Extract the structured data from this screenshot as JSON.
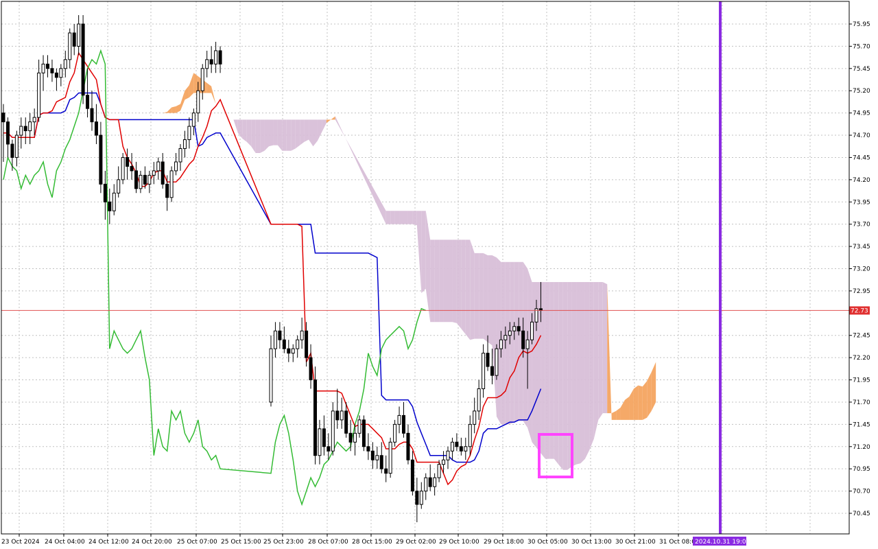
{
  "colors": {
    "background": "#ffffff",
    "grid": "#c0c0c0",
    "bull_candle": "#ffffff",
    "bear_candle": "#000000",
    "tenkan": "#e00000",
    "kijun": "#0000cc",
    "chikou": "#33bb33",
    "cloud_bull": "#f4a460",
    "cloud_bear": "#d8bfd8",
    "current_price_line": "#e05050",
    "vertical_marker": "#8a2be2",
    "highlight_box": "#ff44ff"
  },
  "chart_data": {
    "type": "candlestick",
    "indicator": "Ichimoku Kinko Hyo",
    "grid": true,
    "ylim": [
      70.25,
      76.1
    ],
    "y_ticks": [
      "75.95",
      "75.70",
      "75.45",
      "75.20",
      "74.95",
      "74.70",
      "74.45",
      "74.20",
      "73.95",
      "73.70",
      "73.45",
      "73.20",
      "72.95",
      "72.45",
      "72.20",
      "71.95",
      "71.70",
      "71.45",
      "71.20",
      "70.95",
      "70.70",
      "70.45"
    ],
    "x_ticks": [
      "23 Oct 2024",
      "24 Oct 04:00",
      "24 Oct 12:00",
      "24 Oct 20:00",
      "25 Oct 07:00",
      "25 Oct 15:00",
      "25 Oct 23:00",
      "28 Oct 07:00",
      "28 Oct 15:00",
      "29 Oct 02:00",
      "29 Oct 10:00",
      "29 Oct 18:00",
      "30 Oct 05:00",
      "30 Oct 13:00",
      "30 Oct 21:00",
      "31 Oct 08:00"
    ],
    "current_price": 72.73,
    "current_price_label": "72.73",
    "vertical_marker_label": "2024.10.31 19:00",
    "candles": [
      [
        74.95,
        75.05,
        74.4,
        74.85
      ],
      [
        74.85,
        74.9,
        74.45,
        74.6
      ],
      [
        74.6,
        74.65,
        74.3,
        74.45
      ],
      [
        74.45,
        74.75,
        74.35,
        74.7
      ],
      [
        74.7,
        74.9,
        74.55,
        74.8
      ],
      [
        74.8,
        74.9,
        74.6,
        74.75
      ],
      [
        74.75,
        74.95,
        74.6,
        74.85
      ],
      [
        74.85,
        75.0,
        74.7,
        74.9
      ],
      [
        74.9,
        75.55,
        74.85,
        75.4
      ],
      [
        75.4,
        75.6,
        75.2,
        75.5
      ],
      [
        75.5,
        75.6,
        75.35,
        75.45
      ],
      [
        75.45,
        75.55,
        75.3,
        75.4
      ],
      [
        75.4,
        75.45,
        75.2,
        75.35
      ],
      [
        75.35,
        75.5,
        75.25,
        75.45
      ],
      [
        75.45,
        75.65,
        75.35,
        75.55
      ],
      [
        75.55,
        75.9,
        75.45,
        75.85
      ],
      [
        75.85,
        75.95,
        75.6,
        75.7
      ],
      [
        75.7,
        76.05,
        75.6,
        75.95
      ],
      [
        75.95,
        76.05,
        75.05,
        75.15
      ],
      [
        75.15,
        75.45,
        74.9,
        75.0
      ],
      [
        75.0,
        75.2,
        74.75,
        74.85
      ],
      [
        74.85,
        75.05,
        74.6,
        74.7
      ],
      [
        74.7,
        74.85,
        74.05,
        74.15
      ],
      [
        74.15,
        74.3,
        73.75,
        73.95
      ],
      [
        73.95,
        74.1,
        73.7,
        73.85
      ],
      [
        73.85,
        74.15,
        73.8,
        74.05
      ],
      [
        74.05,
        74.35,
        74.0,
        74.2
      ],
      [
        74.2,
        74.5,
        74.15,
        74.45
      ],
      [
        74.45,
        74.55,
        74.2,
        74.35
      ],
      [
        74.35,
        74.5,
        74.2,
        74.3
      ],
      [
        74.3,
        74.4,
        74.05,
        74.1
      ],
      [
        74.1,
        74.3,
        74.05,
        74.25
      ],
      [
        74.25,
        74.35,
        74.1,
        74.15
      ],
      [
        74.15,
        74.3,
        74.05,
        74.25
      ],
      [
        74.25,
        74.4,
        74.15,
        74.3
      ],
      [
        74.3,
        74.45,
        74.2,
        74.4
      ],
      [
        74.4,
        74.5,
        74.1,
        74.15
      ],
      [
        74.15,
        74.25,
        73.85,
        74.0
      ],
      [
        74.0,
        74.35,
        73.95,
        74.3
      ],
      [
        74.3,
        74.5,
        74.25,
        74.4
      ],
      [
        74.4,
        74.6,
        74.3,
        74.55
      ],
      [
        74.55,
        74.75,
        74.45,
        74.65
      ],
      [
        74.65,
        74.9,
        74.55,
        74.8
      ],
      [
        74.8,
        75.0,
        74.7,
        74.95
      ],
      [
        74.95,
        75.3,
        74.85,
        75.2
      ],
      [
        75.2,
        75.5,
        75.1,
        75.45
      ],
      [
        75.45,
        75.65,
        75.35,
        75.55
      ],
      [
        75.55,
        75.7,
        75.4,
        75.5
      ],
      [
        75.5,
        75.75,
        75.4,
        75.65
      ],
      [
        75.65,
        75.7,
        75.4,
        75.5
      ],
      [
        71.7,
        72.45,
        71.65,
        72.3
      ],
      [
        72.3,
        72.6,
        72.2,
        72.5
      ],
      [
        72.5,
        72.6,
        72.3,
        72.4
      ],
      [
        72.4,
        72.55,
        72.25,
        72.3
      ],
      [
        72.3,
        72.4,
        72.15,
        72.25
      ],
      [
        72.25,
        72.35,
        72.15,
        72.3
      ],
      [
        72.3,
        72.45,
        72.2,
        72.4
      ],
      [
        72.4,
        72.65,
        72.3,
        72.5
      ],
      [
        72.5,
        72.6,
        72.1,
        72.2
      ],
      [
        72.2,
        72.35,
        71.85,
        71.95
      ],
      [
        71.95,
        72.1,
        71.0,
        71.1
      ],
      [
        71.1,
        71.5,
        71.0,
        71.4
      ],
      [
        71.4,
        71.55,
        71.1,
        71.2
      ],
      [
        71.2,
        71.35,
        71.05,
        71.15
      ],
      [
        71.15,
        71.7,
        71.1,
        71.6
      ],
      [
        71.6,
        71.85,
        71.4,
        71.5
      ],
      [
        71.5,
        71.75,
        71.4,
        71.6
      ],
      [
        71.6,
        71.7,
        71.3,
        71.35
      ],
      [
        71.35,
        71.5,
        71.15,
        71.25
      ],
      [
        71.25,
        71.45,
        71.1,
        71.35
      ],
      [
        71.35,
        71.55,
        71.3,
        71.5
      ],
      [
        71.5,
        71.55,
        71.15,
        71.2
      ],
      [
        71.2,
        71.35,
        71.05,
        71.15
      ],
      [
        71.15,
        71.25,
        70.95,
        71.05
      ],
      [
        71.05,
        71.2,
        70.95,
        71.1
      ],
      [
        71.1,
        71.25,
        70.9,
        70.95
      ],
      [
        70.95,
        71.1,
        70.8,
        70.9
      ],
      [
        70.9,
        71.3,
        70.85,
        71.25
      ],
      [
        71.25,
        71.5,
        71.2,
        71.45
      ],
      [
        71.45,
        71.65,
        71.35,
        71.55
      ],
      [
        71.55,
        71.7,
        71.3,
        71.35
      ],
      [
        71.35,
        71.45,
        71.0,
        71.05
      ],
      [
        71.05,
        71.15,
        70.65,
        70.7
      ],
      [
        70.7,
        70.85,
        70.35,
        70.55
      ],
      [
        70.55,
        70.8,
        70.5,
        70.7
      ],
      [
        70.7,
        70.9,
        70.6,
        70.85
      ],
      [
        70.85,
        71.0,
        70.7,
        70.75
      ],
      [
        70.75,
        70.9,
        70.65,
        70.85
      ],
      [
        70.85,
        71.05,
        70.8,
        71.0
      ],
      [
        71.0,
        71.15,
        70.9,
        71.05
      ],
      [
        71.05,
        71.2,
        70.95,
        71.15
      ],
      [
        71.15,
        71.3,
        71.05,
        71.25
      ],
      [
        71.25,
        71.35,
        71.15,
        71.2
      ],
      [
        71.2,
        71.3,
        71.1,
        71.15
      ],
      [
        71.15,
        71.3,
        71.05,
        71.2
      ],
      [
        71.2,
        71.55,
        71.1,
        71.45
      ],
      [
        71.45,
        71.75,
        71.35,
        71.6
      ],
      [
        71.6,
        71.95,
        71.5,
        71.85
      ],
      [
        71.85,
        72.35,
        71.75,
        72.25
      ],
      [
        72.25,
        72.45,
        72.05,
        72.1
      ],
      [
        72.1,
        72.3,
        71.9,
        72.0
      ],
      [
        72.0,
        72.35,
        71.95,
        72.3
      ],
      [
        72.3,
        72.5,
        72.2,
        72.4
      ],
      [
        72.4,
        72.55,
        72.3,
        72.45
      ],
      [
        72.45,
        72.6,
        72.35,
        72.5
      ],
      [
        72.5,
        72.6,
        72.4,
        72.55
      ],
      [
        72.55,
        72.65,
        72.45,
        72.5
      ],
      [
        72.5,
        72.65,
        72.2,
        72.3
      ],
      [
        72.3,
        72.5,
        71.85,
        72.4
      ],
      [
        72.4,
        72.7,
        72.35,
        72.6
      ],
      [
        72.6,
        72.85,
        72.5,
        72.75
      ],
      [
        72.75,
        73.05,
        72.6,
        72.73
      ]
    ]
  }
}
